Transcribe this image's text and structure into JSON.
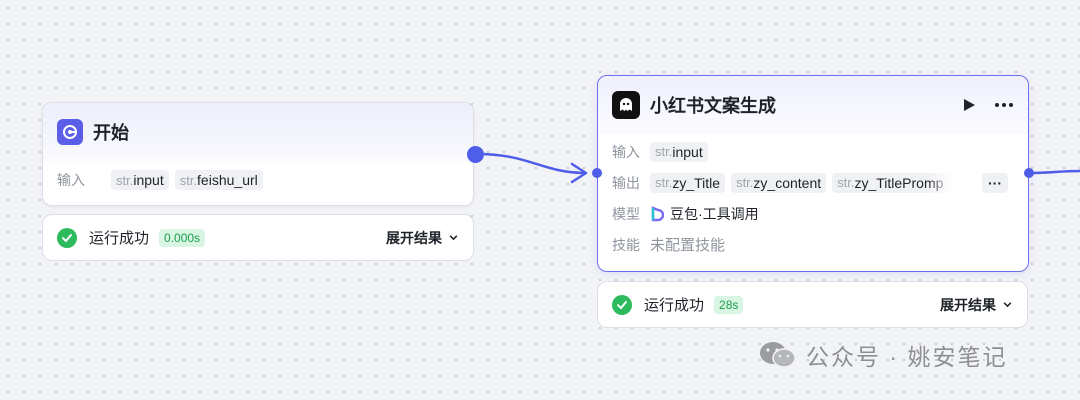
{
  "start_node": {
    "title": "开始",
    "input_label": "输入",
    "inputs": [
      {
        "type": "str.",
        "name": "input"
      },
      {
        "type": "str.",
        "name": "feishu_url"
      }
    ],
    "icon": "start-node-icon"
  },
  "start_status": {
    "text": "运行成功",
    "time": "0.000s",
    "expand_label": "展开结果"
  },
  "llm_node": {
    "title": "小红书文案生成",
    "icon": "ghost-bot-icon",
    "input_label": "输入",
    "inputs": [
      {
        "type": "str.",
        "name": "input"
      }
    ],
    "output_label": "输出",
    "outputs": [
      {
        "type": "str.",
        "name": "zy_Title"
      },
      {
        "type": "str.",
        "name": "zy_content"
      },
      {
        "type": "str.",
        "name": "zy_TitlePromp"
      }
    ],
    "more_label": "···",
    "model_label": "模型",
    "model_value": "豆包·工具调用",
    "skill_label": "技能",
    "skill_value": "未配置技能"
  },
  "llm_status": {
    "text": "运行成功",
    "time": "28s",
    "expand_label": "展开结果"
  },
  "watermark": {
    "text": "公众号 · 姚安笔记"
  },
  "colors": {
    "accent": "#4e5ee8",
    "success": "#2dbb5d",
    "success_bg": "#d9f5e3"
  }
}
